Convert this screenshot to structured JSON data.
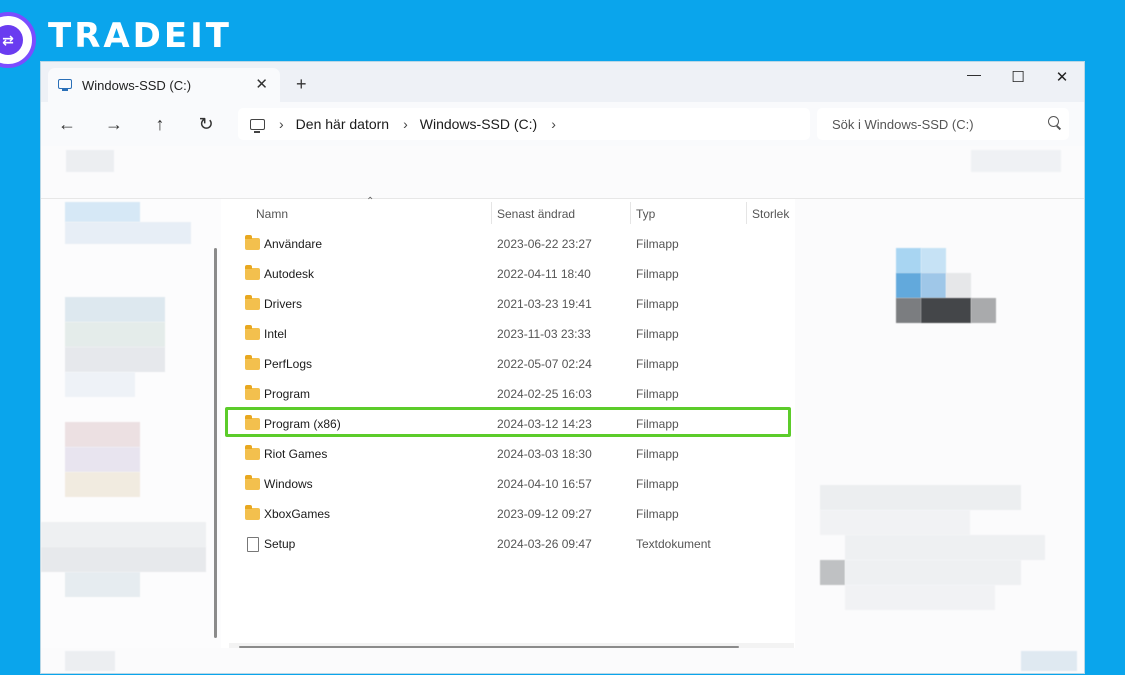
{
  "brand": {
    "name": "TRADEIT"
  },
  "window": {
    "tab_label": "Windows-SSD (C:)",
    "tab_close": "✕",
    "tab_add": "+",
    "controls": {
      "minimize": "—",
      "maximize": "☐",
      "close": "✕"
    }
  },
  "nav": {
    "back": "←",
    "forward": "→",
    "up": "↑",
    "refresh": "↻",
    "breadcrumb": [
      "Den här datorn",
      "Windows-SSD (C:)"
    ],
    "separator": "›",
    "search_placeholder": "Sök i Windows-SSD (C:)"
  },
  "columns": {
    "name": "Namn",
    "modified": "Senast ändrad",
    "type": "Typ",
    "size": "Storlek"
  },
  "files": [
    {
      "name": "Användare",
      "modified": "2023-06-22 23:27",
      "type": "Filmapp",
      "icon": "folder-icon"
    },
    {
      "name": "Autodesk",
      "modified": "2022-04-11 18:40",
      "type": "Filmapp",
      "icon": "folder-icon"
    },
    {
      "name": "Drivers",
      "modified": "2021-03-23 19:41",
      "type": "Filmapp",
      "icon": "folder-icon"
    },
    {
      "name": "Intel",
      "modified": "2023-11-03 23:33",
      "type": "Filmapp",
      "icon": "folder-icon"
    },
    {
      "name": "PerfLogs",
      "modified": "2022-05-07 02:24",
      "type": "Filmapp",
      "icon": "folder-icon"
    },
    {
      "name": "Program",
      "modified": "2024-02-25 16:03",
      "type": "Filmapp",
      "icon": "folder-icon"
    },
    {
      "name": "Program (x86)",
      "modified": "2024-03-12 14:23",
      "type": "Filmapp",
      "icon": "folder-icon",
      "highlighted": true
    },
    {
      "name": "Riot Games",
      "modified": "2024-03-03 18:30",
      "type": "Filmapp",
      "icon": "folder-icon"
    },
    {
      "name": "Windows",
      "modified": "2024-04-10 16:57",
      "type": "Filmapp",
      "icon": "folder-icon"
    },
    {
      "name": "XboxGames",
      "modified": "2023-09-12 09:27",
      "type": "Filmapp",
      "icon": "folder-icon"
    },
    {
      "name": "Setup",
      "modified": "2024-03-26 09:47",
      "type": "Textdokument",
      "icon": "text-file-icon"
    }
  ],
  "colors": {
    "background": "#0aa5ec",
    "highlight": "#5ccc2a",
    "folder": "#f3c04e"
  }
}
